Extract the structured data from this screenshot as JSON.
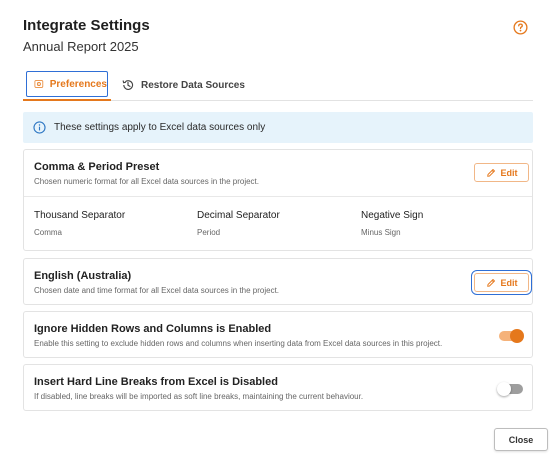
{
  "header": {
    "title": "Integrate Settings",
    "subtitle": "Annual Report 2025",
    "help_icon": "question-circle-icon"
  },
  "tabs": [
    {
      "label": "Preferences",
      "icon": "gear-doc-icon",
      "active": true
    },
    {
      "label": "Restore Data Sources",
      "icon": "history-icon",
      "active": false
    }
  ],
  "banner": {
    "text": "These settings apply to Excel data sources only",
    "icon": "info-icon"
  },
  "number_format": {
    "title": "Comma & Period Preset",
    "description": "Chosen numeric format for all Excel data sources in the project.",
    "edit_label": "Edit",
    "columns": [
      {
        "header": "Thousand Separator",
        "value": "Comma"
      },
      {
        "header": "Decimal Separator",
        "value": "Period"
      },
      {
        "header": "Negative Sign",
        "value": "Minus Sign"
      }
    ]
  },
  "date_format": {
    "title": "English (Australia)",
    "description": "Chosen date and time format for all Excel data sources in the project.",
    "edit_label": "Edit"
  },
  "hidden_rows": {
    "title": "Ignore Hidden Rows and Columns is Enabled",
    "description": "Enable this setting to exclude hidden rows and columns when inserting data from Excel data sources in this project.",
    "enabled": true
  },
  "line_breaks": {
    "title": "Insert Hard Line Breaks from Excel is Disabled",
    "description": "If disabled, line breaks will be imported as soft line breaks, maintaining the current behaviour.",
    "enabled": false
  },
  "footer": {
    "close_label": "Close"
  },
  "colors": {
    "accent": "#e5781c",
    "focus": "#2f6fd6",
    "banner_bg": "#e6f3fb"
  }
}
